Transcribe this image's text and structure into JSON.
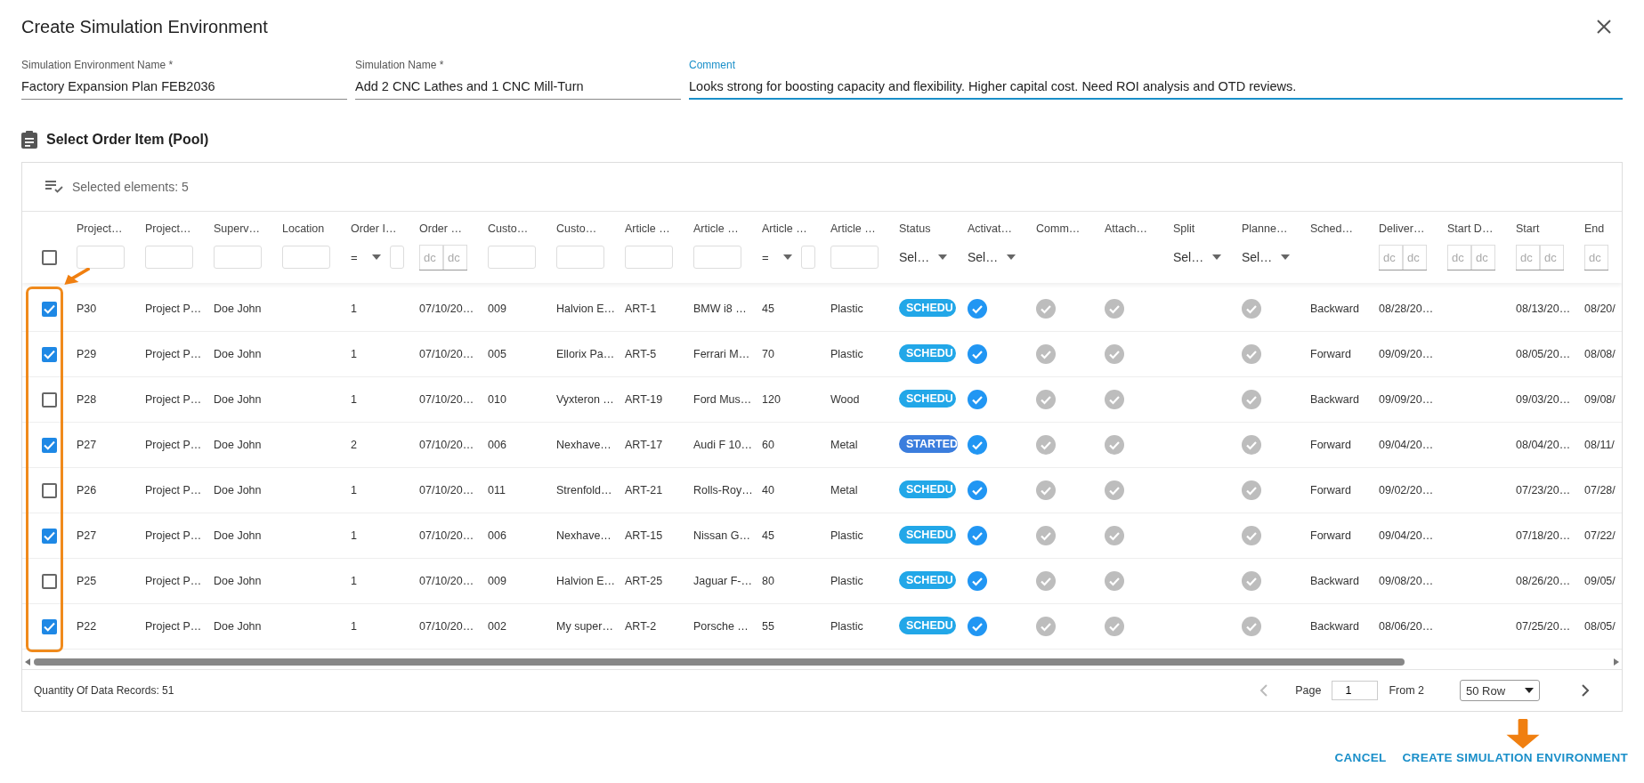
{
  "dialog": {
    "title": "Create Simulation Environment"
  },
  "fields": [
    {
      "label": "Simulation Environment Name *",
      "value": "Factory Expansion Plan FEB2036",
      "focused": false
    },
    {
      "label": "Simulation Name *",
      "value": "Add 2 CNC Lathes and 1 CNC Mill-Turn",
      "focused": false
    },
    {
      "label": "Comment",
      "value": "Looks strong for boosting capacity and flexibility. Higher capital cost. Need ROI analysis and OTD reviews.",
      "focused": true
    }
  ],
  "section": {
    "title": "Select Order Item (Pool)"
  },
  "toolbar": {
    "selected_text": "Selected elements: 5"
  },
  "table": {
    "all_selected": false,
    "columns": [
      {
        "label": "Project…",
        "filter": {
          "kind": "text"
        }
      },
      {
        "label": "Project…",
        "filter": {
          "kind": "text"
        }
      },
      {
        "label": "Superv…",
        "filter": {
          "kind": "text"
        }
      },
      {
        "label": "Location",
        "filter": {
          "kind": "text"
        }
      },
      {
        "label": "Order I…",
        "filter": {
          "kind": "eq",
          "operator": "="
        }
      },
      {
        "label": "Order …",
        "filter": {
          "kind": "date",
          "placeholders": [
            "dc",
            "dc"
          ]
        }
      },
      {
        "label": "Custo…",
        "filter": {
          "kind": "text"
        }
      },
      {
        "label": "Custo…",
        "filter": {
          "kind": "text"
        }
      },
      {
        "label": "Article …",
        "filter": {
          "kind": "text"
        }
      },
      {
        "label": "Article …",
        "filter": {
          "kind": "text"
        }
      },
      {
        "label": "Article …",
        "filter": {
          "kind": "eq",
          "operator": "="
        }
      },
      {
        "label": "Article …",
        "filter": {
          "kind": "text"
        }
      },
      {
        "label": "Status",
        "filter": {
          "kind": "select",
          "value": "Sel…"
        }
      },
      {
        "label": "Activat…",
        "filter": {
          "kind": "select",
          "value": "Sel…"
        }
      },
      {
        "label": "Comm…",
        "filter": {
          "kind": "none"
        }
      },
      {
        "label": "Attach…",
        "filter": {
          "kind": "none"
        }
      },
      {
        "label": "Split",
        "filter": {
          "kind": "select",
          "value": "Sel…"
        }
      },
      {
        "label": "Planne…",
        "filter": {
          "kind": "select",
          "value": "Sel…"
        }
      },
      {
        "label": "Sched…",
        "filter": {
          "kind": "none"
        }
      },
      {
        "label": "Deliver…",
        "filter": {
          "kind": "date",
          "placeholders": [
            "dc",
            "dc"
          ]
        }
      },
      {
        "label": "Start D…",
        "filter": {
          "kind": "date",
          "placeholders": [
            "dc",
            "dc"
          ]
        }
      },
      {
        "label": "Start",
        "filter": {
          "kind": "date",
          "placeholders": [
            "dc",
            "dc"
          ]
        }
      },
      {
        "label": "End",
        "filter": {
          "kind": "date",
          "placeholders": [
            "dc"
          ]
        }
      }
    ],
    "rows": [
      {
        "selected": true,
        "cells": [
          "P30",
          "Project P…",
          "Doe John",
          null,
          "1",
          "07/10/20…",
          "009",
          "Halvion E…",
          "ART-1",
          "BMW i8 …",
          "45",
          "Plastic",
          {
            "text": "SCHEDU",
            "color": "#22a7e8"
          },
          true,
          false,
          false,
          null,
          false,
          "Backward",
          "08/28/20…",
          null,
          "08/13/20…",
          "08/20/"
        ]
      },
      {
        "selected": true,
        "cells": [
          "P29",
          "Project P…",
          "Doe John",
          null,
          "1",
          "07/10/20…",
          "005",
          "Ellorix Pa…",
          "ART-5",
          "Ferrari M…",
          "70",
          "Plastic",
          {
            "text": "SCHEDU",
            "color": "#22a7e8"
          },
          true,
          false,
          false,
          null,
          false,
          "Forward",
          "09/09/20…",
          null,
          "08/05/20…",
          "08/08/"
        ]
      },
      {
        "selected": false,
        "cells": [
          "P28",
          "Project P…",
          "Doe John",
          null,
          "1",
          "07/10/20…",
          "010",
          "Vyxteron …",
          "ART-19",
          "Ford Mus…",
          "120",
          "Wood",
          {
            "text": "SCHEDU",
            "color": "#22a7e8"
          },
          true,
          false,
          false,
          null,
          false,
          "Backward",
          "09/09/20…",
          null,
          "09/03/20…",
          "09/08/"
        ]
      },
      {
        "selected": true,
        "cells": [
          "P27",
          "Project P…",
          "Doe John",
          null,
          "2",
          "07/10/20…",
          "006",
          "Nexhave…",
          "ART-17",
          "Audi F 10…",
          "60",
          "Metal",
          {
            "text": "STARTED",
            "color": "#3b7ddd"
          },
          true,
          false,
          false,
          null,
          false,
          "Forward",
          "09/04/20…",
          null,
          "08/04/20…",
          "08/11/"
        ]
      },
      {
        "selected": false,
        "cells": [
          "P26",
          "Project P…",
          "Doe John",
          null,
          "1",
          "07/10/20…",
          "011",
          "Strenfold…",
          "ART-21",
          "Rolls-Roy…",
          "40",
          "Metal",
          {
            "text": "SCHEDU",
            "color": "#22a7e8"
          },
          true,
          false,
          false,
          null,
          false,
          "Forward",
          "09/02/20…",
          null,
          "07/23/20…",
          "07/28/"
        ]
      },
      {
        "selected": true,
        "cells": [
          "P27",
          "Project P…",
          "Doe John",
          null,
          "1",
          "07/10/20…",
          "006",
          "Nexhave…",
          "ART-15",
          "Nissan G…",
          "45",
          "Plastic",
          {
            "text": "SCHEDU",
            "color": "#22a7e8"
          },
          true,
          false,
          false,
          null,
          false,
          "Forward",
          "09/04/20…",
          null,
          "07/18/20…",
          "07/22/"
        ]
      },
      {
        "selected": false,
        "cells": [
          "P25",
          "Project P…",
          "Doe John",
          null,
          "1",
          "07/10/20…",
          "009",
          "Halvion E…",
          "ART-25",
          "Jaguar F-…",
          "80",
          "Plastic",
          {
            "text": "SCHEDU",
            "color": "#22a7e8"
          },
          true,
          false,
          false,
          null,
          false,
          "Backward",
          "09/08/20…",
          null,
          "08/26/20…",
          "09/05/"
        ]
      },
      {
        "selected": true,
        "cells": [
          "P22",
          "Project P…",
          "Doe John",
          null,
          "1",
          "07/10/20…",
          "002",
          "My super…",
          "ART-2",
          "Porsche …",
          "55",
          "Plastic",
          {
            "text": "SCHEDU",
            "color": "#22a7e8"
          },
          true,
          false,
          false,
          null,
          false,
          "Backward",
          "08/06/20…",
          null,
          "07/25/20…",
          "08/05/"
        ]
      }
    ]
  },
  "footer": {
    "records": "Quantity Of Data Records: 51",
    "page_label": "Page",
    "page": "1",
    "total": "From 2",
    "page_size": "50 Row"
  },
  "buttons": [
    {
      "label": "CANCEL"
    },
    {
      "label": "CREATE SIMULATION ENVIRONMENT"
    }
  ]
}
